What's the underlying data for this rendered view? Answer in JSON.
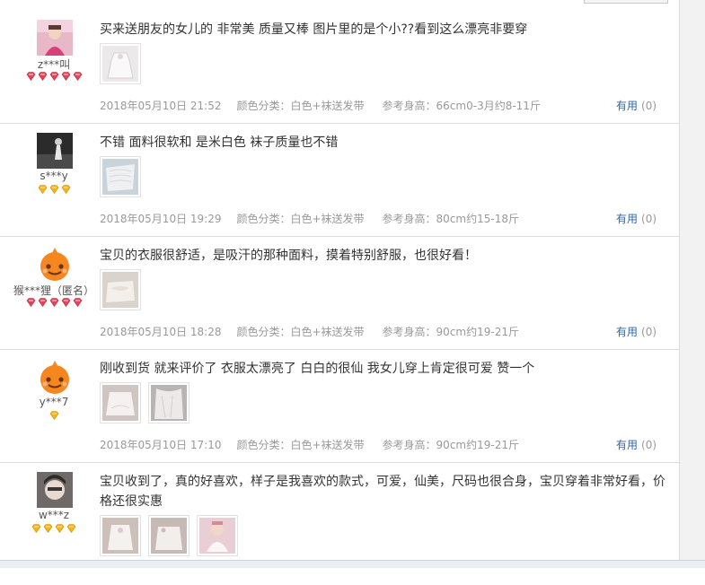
{
  "reviews": [
    {
      "user": "z***叫",
      "avatar": "photo-avatar-pink",
      "rank": {
        "icon": "red-diamond-icon",
        "count": 5,
        "color": "#e0455a"
      },
      "text": "买来送朋友的女儿的 非常美 质量又棒 图片里的是个小??看到这么漂亮非要穿",
      "photos": [
        "review-photo-white-dress"
      ],
      "date": "2018年05月10日 21:52",
      "color_class": "颜色分类：白色+袜送发带",
      "ref_height": "参考身高：66cm0-3月约8-11斤",
      "useful_label": "有用",
      "useful_count": "(0)"
    },
    {
      "user": "s***y",
      "avatar": "photo-avatar-dark",
      "rank": {
        "icon": "yellow-diamond-icon",
        "count": 3,
        "color": "#f3b51a"
      },
      "text": "不错 面料很软和 是米白色 袜子质量也不错",
      "photos": [
        "review-photo-lace-fabric"
      ],
      "date": "2018年05月10日 19:29",
      "color_class": "颜色分类：白色+袜送发带",
      "ref_height": "参考身高：80cm约15-18斤",
      "useful_label": "有用",
      "useful_count": "(0)"
    },
    {
      "user": "猴***狸（匿名）",
      "avatar": "default-avatar-orange",
      "rank": {
        "icon": "red-diamond-icon",
        "count": 5,
        "color": "#e0455a"
      },
      "text": "宝贝的衣服很舒适，是吸汗的那种面料，摸着特别舒服，也很好看！",
      "photos": [
        "review-photo-white-dress-folded"
      ],
      "date": "2018年05月10日 18:28",
      "color_class": "颜色分类：白色+袜送发带",
      "ref_height": "参考身高：90cm约19-21斤",
      "useful_label": "有用",
      "useful_count": "(0)"
    },
    {
      "user": "y***7",
      "avatar": "default-avatar-orange",
      "rank": {
        "icon": "yellow-diamond-icon",
        "count": 1,
        "color": "#f3b51a"
      },
      "text": "刚收到货 就来评价了 衣服太漂亮了 白白的很仙 我女儿穿上肯定很可爱 赞一个",
      "photos": [
        "review-photo-dress-closeup",
        "review-photo-dress-fabric"
      ],
      "date": "2018年05月10日 17:10",
      "color_class": "颜色分类：白色+袜送发带",
      "ref_height": "参考身高：90cm约19-21斤",
      "useful_label": "有用",
      "useful_count": "(0)"
    },
    {
      "user": "w***z",
      "avatar": "photo-avatar-face",
      "rank": {
        "icon": "yellow-diamond-icon",
        "count": 4,
        "color": "#f3b51a"
      },
      "text": "宝贝收到了，真的好喜欢，样子是我喜欢的款式，可爱，仙美，尺码也很合身，宝贝穿着非常好看，价格还很实惠",
      "photos": [
        "review-photo-dress-set",
        "review-photo-dress-set-2",
        "review-photo-baby-wearing"
      ],
      "date": "",
      "color_class": "",
      "ref_height": "",
      "useful_label": "",
      "useful_count": ""
    }
  ]
}
